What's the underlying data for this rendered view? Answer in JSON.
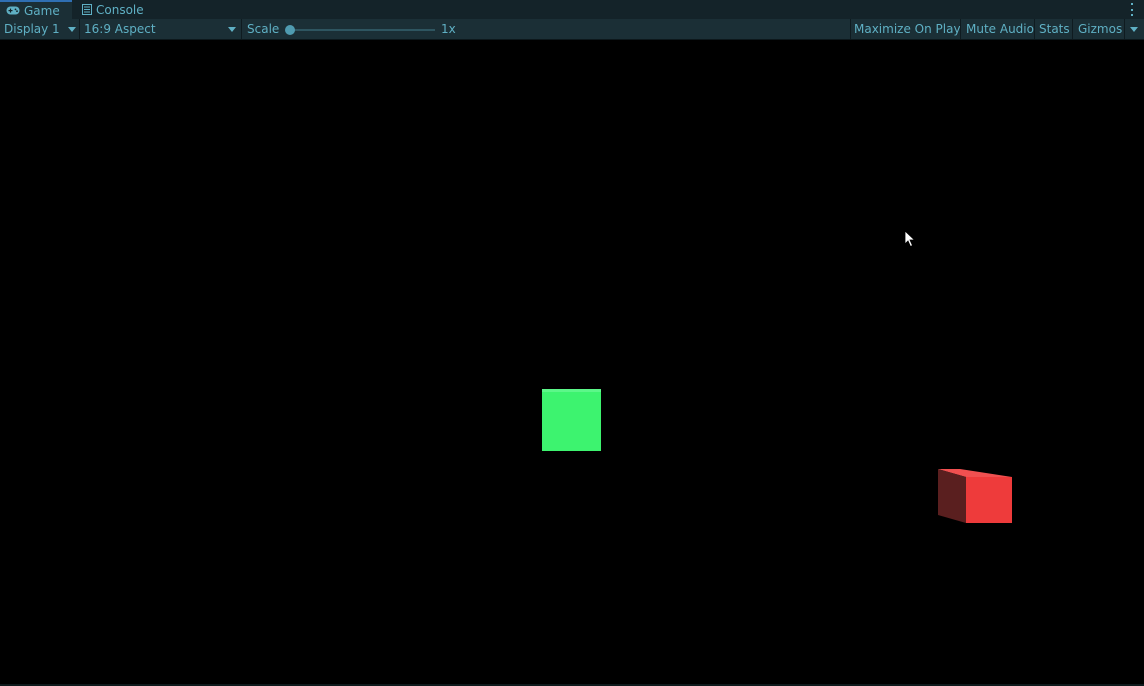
{
  "tabs": [
    {
      "label": "Game",
      "icon": "gamepad-icon",
      "active": true
    },
    {
      "label": "Console",
      "icon": "console-icon",
      "active": false
    }
  ],
  "toolbar": {
    "display": "Display 1",
    "aspect": "16:9 Aspect",
    "scale_label": "Scale",
    "scale_value": "1x",
    "scale_slider_fraction": 0.0,
    "maximize_on_play": "Maximize On Play",
    "mute_audio": "Mute Audio",
    "stats": "Stats",
    "gizmos": "Gizmos"
  },
  "scene": {
    "objects": [
      {
        "name": "green-cube",
        "color": "#3df36f"
      },
      {
        "name": "red-cube",
        "front_color": "#ee3b3b",
        "side_color": "#5a1f1f",
        "top_color": "#f05050"
      }
    ]
  },
  "colors": {
    "accent": "#2f6fb3",
    "text": "#5fb0c4",
    "toolbar_bg": "#1b2f36"
  }
}
